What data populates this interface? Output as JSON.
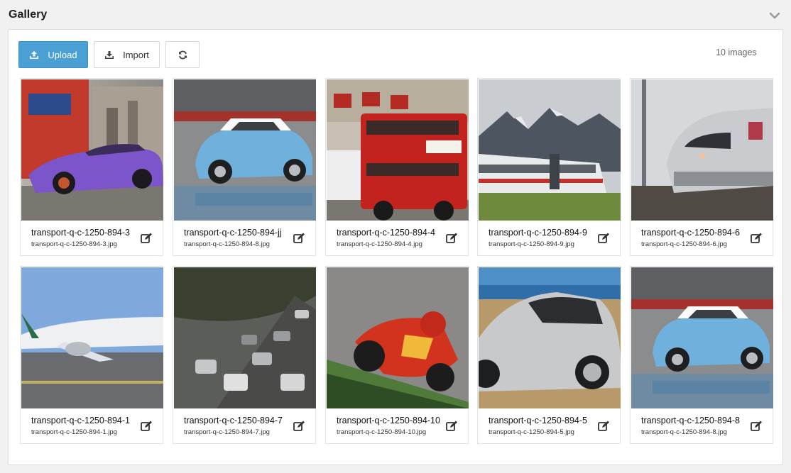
{
  "header": {
    "title": "Gallery"
  },
  "toolbar": {
    "upload_label": "Upload",
    "import_label": "Import",
    "image_count": "10 images"
  },
  "colors": {
    "primary": "#4a9fd4",
    "panel_bg": "#ffffff",
    "page_bg": "#f1f1f1"
  },
  "gallery": {
    "items": [
      {
        "title": "transport-q-c-1250-894-3",
        "filename": "transport-q-c-1250-894-3.jpg",
        "scene": "purple sports car passing red bus"
      },
      {
        "title": "transport-q-c-1250-894-jj",
        "filename": "transport-q-c-1250-894-8.jpg",
        "scene": "blue mini car on wet track"
      },
      {
        "title": "transport-q-c-1250-894-4",
        "filename": "transport-q-c-1250-894-4.jpg",
        "scene": "red double-decker bus"
      },
      {
        "title": "transport-q-c-1250-894-9",
        "filename": "transport-q-c-1250-894-9.jpg",
        "scene": "train in front of mountains"
      },
      {
        "title": "transport-q-c-1250-894-6",
        "filename": "transport-q-c-1250-894-6.jpg",
        "scene": "high-speed train at station"
      },
      {
        "title": "transport-q-c-1250-894-1",
        "filename": "transport-q-c-1250-894-1.jpg",
        "scene": "airliner on tarmac"
      },
      {
        "title": "transport-q-c-1250-894-7",
        "filename": "transport-q-c-1250-894-7.jpg",
        "scene": "traffic jam on road"
      },
      {
        "title": "transport-q-c-1250-894-10",
        "filename": "transport-q-c-1250-894-10.jpg",
        "scene": "red motorcycle racer leaning"
      },
      {
        "title": "transport-q-c-1250-894-5",
        "filename": "transport-q-c-1250-894-5.jpg",
        "scene": "silver sports car by sea"
      },
      {
        "title": "transport-q-c-1250-894-8",
        "filename": "transport-q-c-1250-894-8.jpg",
        "scene": "blue mini car on wet track"
      }
    ]
  }
}
